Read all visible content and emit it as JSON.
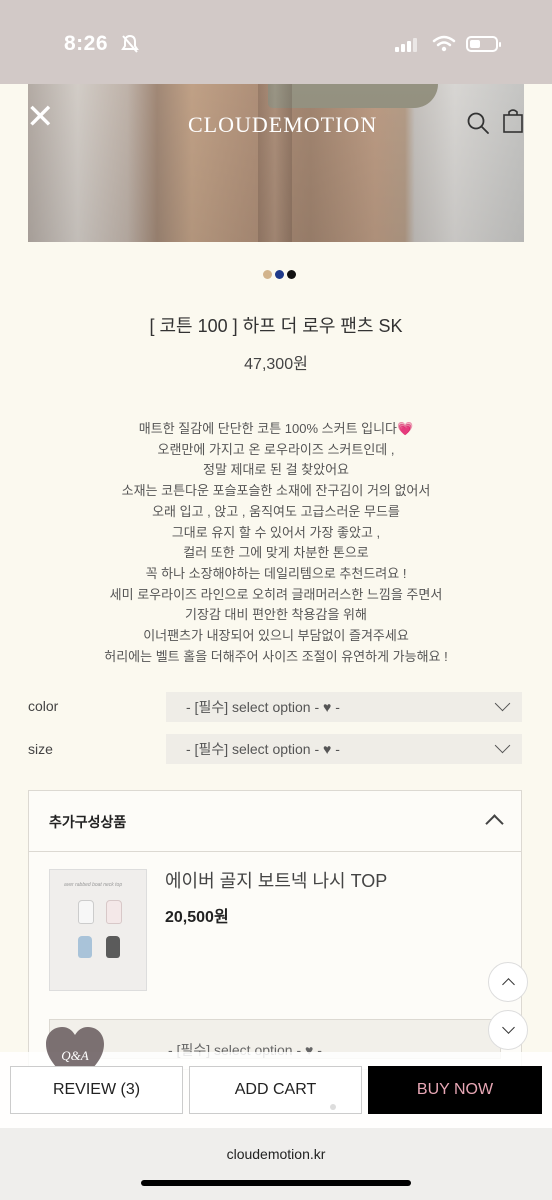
{
  "status_bar": {
    "time": "8:26"
  },
  "header": {
    "brand": "CLOUDEMOTION",
    "icons": [
      "close-icon",
      "search-icon",
      "shopping-bag-icon"
    ]
  },
  "color_swatches": [
    "#d2b48c",
    "#1f3a8a",
    "#111111"
  ],
  "product": {
    "title": "[ 코튼 100 ] 하프 더 로우 팬츠 SK",
    "price": "47,300원",
    "description": [
      "매트한 질감에 단단한 코튼 100% 스커트 입니다💗",
      "오랜만에 가지고 온 로우라이즈 스커트인데 ,",
      "정말 제대로 된 걸 찾았어요",
      "소재는 코튼다운 포슬포슬한 소재에 잔구김이 거의 없어서",
      "오래 입고 , 앉고 , 움직여도 고급스러운 무드를",
      "그대로 유지 할 수 있어서 가장 좋았고 ,",
      "컬러 또한 그에 맞게 차분한 톤으로",
      "꼭 하나 소장해야하는 데일리템으로 추천드려요 !",
      "세미 로우라이즈 라인으로 오히려 글래머러스한 느낌을 주면서",
      "기장감 대비 편안한 착용감을 위해",
      "이너팬츠가 내장되어 있으니 부담없이 즐겨주세요",
      "허리에는 벨트 홀을 더해주어 사이즈 조절이 유연하게 가능해요 !"
    ]
  },
  "options": [
    {
      "label": "color",
      "value": "- [필수] select option - ♥ -"
    },
    {
      "label": "size",
      "value": "- [필수] select option - ♥ -"
    }
  ],
  "addon": {
    "title": "추가구성상품",
    "item_name": "에이버 골지 보트넥 나시 TOP",
    "item_price": "20,500원",
    "select_value": "- [필수] select option - ♥ -"
  },
  "floating": {
    "qna_label": "Q&A"
  },
  "bottom_buttons": {
    "review": "REVIEW (3)",
    "add_cart": "ADD CART",
    "buy_now": "BUY NOW"
  },
  "browser": {
    "url": "cloudemotion.kr"
  }
}
